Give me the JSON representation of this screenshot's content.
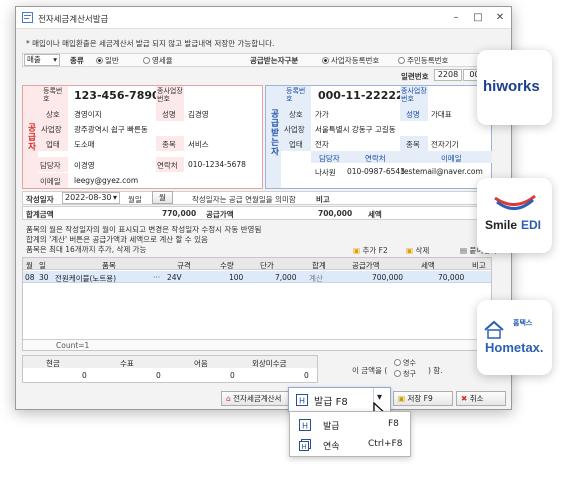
{
  "window": {
    "title": "전자세금계산서발급"
  },
  "notice": "* 매입이나 매입환출은 세금계산서 발급 되지 않고 발급내역 저장만 가능합니다.",
  "topbar": {
    "sale_type": "매출",
    "kind_label": "종류",
    "kind_general": "일반",
    "kind_zero": "영세율",
    "recipient_label": "공급받는자구분",
    "recipient_biz": "사업자등록번호",
    "recipient_resident": "주민등록번호",
    "serial_label": "일련번호",
    "serial_value": "2208",
    "serial_value2": "000"
  },
  "supplier": {
    "section": "공급자",
    "regno_label": "등록번호",
    "regno": "123-456-78901",
    "subno_label": "종사업장번호",
    "name_label": "상호",
    "name": "경영이지",
    "ceo_label": "성명",
    "ceo": "김경영",
    "addr_label": "사업장",
    "addr": "광주광역시 쉽구 빠른동",
    "type_label": "업태",
    "type": "도소매",
    "item_label": "종목",
    "item": "서비스",
    "manager_label": "담당자",
    "manager": "이경영",
    "contact_label": "연락처",
    "contact": "010-1234-5678",
    "email_label": "이메일",
    "email": "leegy@gyez.com"
  },
  "buyer": {
    "section": "공급받는자",
    "regno_label": "등록번호",
    "regno": "000-11-22222",
    "subno_label": "종사업장번호",
    "name_label": "상호",
    "name": "가가",
    "ceo_label": "성명",
    "ceo": "가대표",
    "addr_label": "사업장",
    "addr": "서울특별시 강동구 고길동",
    "type_label": "업태",
    "type": "전자",
    "item_label": "종목",
    "item": "전자기기",
    "col_manager": "담당자",
    "col_contact": "연락처",
    "col_email": "이메일",
    "manager": "나사원",
    "contact": "010-0987-6543",
    "email": "testemail@naver.com"
  },
  "dates": {
    "write_label": "작성일자",
    "write_value": "2022-08-30",
    "month_label": "월일",
    "month_btn": "월",
    "hint": "작성일자는 공급 연월일을 의미함",
    "note_label": "비고"
  },
  "totals": {
    "total_label": "합계금액",
    "total_value": "770,000",
    "supply_label": "공급가액",
    "supply_value": "700,000",
    "tax_label": "세액"
  },
  "info_lines": [
    "품목의 월은 작성일자의 월이 표시되고 변경은 작성일자 수정시 자동 반영됨",
    "합계의 '계산' 버튼은 공급가액과 세액으로 계산 할 수 있음",
    "품목은 최대 16개까지 추가, 삭제 가능"
  ],
  "item_buttons": {
    "add": "추가 F2",
    "delete": "삭제",
    "paste": "붙여넣기"
  },
  "grid": {
    "headers": [
      "월",
      "일",
      "품목",
      "규격",
      "수량",
      "단가",
      "합계",
      "공급가액",
      "세액",
      "비고"
    ],
    "row": {
      "month": "08",
      "day": "30",
      "item": "전원케이블(노트용)",
      "spec": "24V",
      "qty": "100",
      "price": "7,000",
      "calc": "계산",
      "supply": "700,000",
      "tax": "70,000",
      "note": ""
    },
    "count": "Count=1"
  },
  "payment": {
    "headers": [
      "현금",
      "수표",
      "어음",
      "외상미수금"
    ],
    "values": [
      "0",
      "0",
      "0",
      "0"
    ],
    "amount_prefix": "이 금액을 (",
    "receipt": "영수",
    "claim": "청구",
    "amount_suffix": ") 함."
  },
  "footer": {
    "invoice_btn": "전자세금계산서",
    "issue_btn": "발급 F8",
    "save_btn": "저장 F9",
    "cancel_btn": "취소"
  },
  "dropdown": [
    {
      "label": "발급",
      "shortcut": "F8"
    },
    {
      "label": "연속",
      "shortcut": "Ctrl+F8"
    }
  ],
  "partners": {
    "hiworks": "hiworks",
    "smileedi_a": "Smile",
    "smileedi_b": "EDI",
    "hometax_a": "홈택스",
    "hometax_b": "Hometax."
  },
  "colors": {
    "red": "#d42020",
    "blue": "#1b4fa8",
    "pink": "#fde9ea",
    "lightblue": "#e5edf8"
  }
}
